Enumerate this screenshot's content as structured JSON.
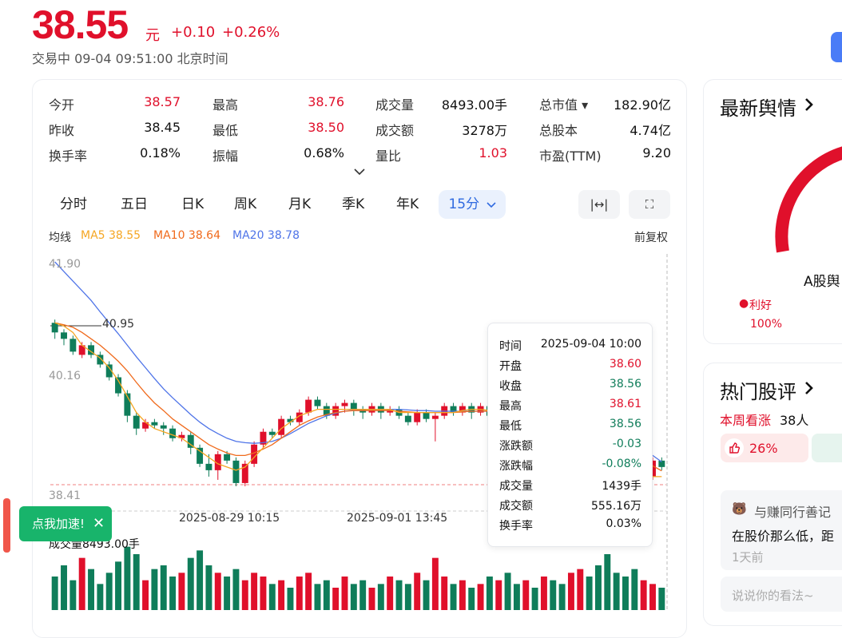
{
  "header": {
    "price": "38.55",
    "unit": "元",
    "change": "+0.10",
    "change_pct": "+0.26%",
    "status": "交易中  09-04 09:51:00  北京时间"
  },
  "quote": [
    {
      "label": "今开",
      "value": "38.57",
      "color": "red"
    },
    {
      "label": "最高",
      "value": "38.76",
      "color": "red"
    },
    {
      "label": "成交量",
      "value": "8493.00手",
      "color": "dark"
    },
    {
      "label": "总市值 ▾",
      "value": "182.90亿",
      "color": "dark"
    },
    {
      "label": "昨收",
      "value": "38.45",
      "color": "dark"
    },
    {
      "label": "最低",
      "value": "38.50",
      "color": "red"
    },
    {
      "label": "成交额",
      "value": "3278万",
      "color": "dark"
    },
    {
      "label": "总股本",
      "value": "4.74亿",
      "color": "dark"
    },
    {
      "label": "换手率",
      "value": "0.18%",
      "color": "dark"
    },
    {
      "label": "振幅",
      "value": "0.68%",
      "color": "dark"
    },
    {
      "label": "量比",
      "value": "1.03",
      "color": "red"
    },
    {
      "label": "市盈(TTM)",
      "value": "9.20",
      "color": "dark"
    }
  ],
  "tabs": [
    "分时",
    "五日",
    "日K",
    "周K",
    "月K",
    "季K",
    "年K",
    "15分"
  ],
  "tools": {
    "fit": "|↔|",
    "fullscreen": "⛶"
  },
  "ma": {
    "avg": "均线",
    "ma5": "MA5 38.55",
    "ma10": "MA10 38.64",
    "ma20": "MA20 38.78",
    "adjust": "前复权",
    "colors": {
      "ma5": "#f5a623",
      "ma10": "#f06a1c",
      "ma20": "#4f74e8"
    }
  },
  "chart_data": {
    "type": "candlestick",
    "y_ticks": [
      "41.90",
      "40.16",
      "38.41"
    ],
    "x_ticks": [
      "2025-08-29 10:15",
      "2025-09-01 13:45"
    ],
    "max_marker": "40.95",
    "volume_label": "成交量8493.00手",
    "candles": [
      [
        40.95,
        40.8,
        41.0,
        40.7
      ],
      [
        40.8,
        40.7,
        40.85,
        40.6
      ],
      [
        40.7,
        40.5,
        40.75,
        40.45
      ],
      [
        40.45,
        40.6,
        40.65,
        40.4
      ],
      [
        40.6,
        40.45,
        40.65,
        40.4
      ],
      [
        40.45,
        40.3,
        40.5,
        40.25
      ],
      [
        40.3,
        40.1,
        40.35,
        40.05
      ],
      [
        40.1,
        39.85,
        40.15,
        39.8
      ],
      [
        39.85,
        39.5,
        39.9,
        39.4
      ],
      [
        39.5,
        39.3,
        39.55,
        39.2
      ],
      [
        39.3,
        39.4,
        39.45,
        39.25
      ],
      [
        39.4,
        39.35,
        39.45,
        39.3
      ],
      [
        39.35,
        39.3,
        39.4,
        39.2
      ],
      [
        39.3,
        39.15,
        39.35,
        39.1
      ],
      [
        39.15,
        39.2,
        39.25,
        39.1
      ],
      [
        39.2,
        39.0,
        39.25,
        38.9
      ],
      [
        39.0,
        38.75,
        39.05,
        38.7
      ],
      [
        38.75,
        38.65,
        38.9,
        38.55
      ],
      [
        38.65,
        38.9,
        38.95,
        38.5
      ],
      [
        38.9,
        38.8,
        38.95,
        38.75
      ],
      [
        38.8,
        38.45,
        38.85,
        38.4
      ],
      [
        38.45,
        38.75,
        38.8,
        38.4
      ],
      [
        38.75,
        39.05,
        39.1,
        38.7
      ],
      [
        39.05,
        39.25,
        39.3,
        39.0
      ],
      [
        39.25,
        39.2,
        39.3,
        39.15
      ],
      [
        39.2,
        39.45,
        39.5,
        39.15
      ],
      [
        39.45,
        39.4,
        39.5,
        39.35
      ],
      [
        39.4,
        39.55,
        39.6,
        39.35
      ],
      [
        39.55,
        39.75,
        39.8,
        39.5
      ],
      [
        39.75,
        39.65,
        39.8,
        39.6
      ],
      [
        39.65,
        39.5,
        39.7,
        39.45
      ],
      [
        39.5,
        39.65,
        39.7,
        39.45
      ],
      [
        39.65,
        39.7,
        39.75,
        39.55
      ],
      [
        39.7,
        39.6,
        39.75,
        39.5
      ],
      [
        39.6,
        39.55,
        39.65,
        39.45
      ],
      [
        39.55,
        39.65,
        39.7,
        39.5
      ],
      [
        39.65,
        39.55,
        39.7,
        39.45
      ],
      [
        39.55,
        39.6,
        39.65,
        39.5
      ],
      [
        39.6,
        39.5,
        39.65,
        39.45
      ],
      [
        39.5,
        39.4,
        39.55,
        39.35
      ],
      [
        39.4,
        39.55,
        39.6,
        39.35
      ],
      [
        39.55,
        39.45,
        39.6,
        39.4
      ],
      [
        39.45,
        39.5,
        39.55,
        39.1
      ],
      [
        39.5,
        39.65,
        39.7,
        39.45
      ],
      [
        39.65,
        39.55,
        39.7,
        39.5
      ],
      [
        39.55,
        39.65,
        39.7,
        39.5
      ],
      [
        39.65,
        39.55,
        39.7,
        39.45
      ],
      [
        39.55,
        39.65,
        39.7,
        39.5
      ],
      [
        39.65,
        39.5,
        39.7,
        39.45
      ],
      [
        39.5,
        39.55,
        39.6,
        39.45
      ],
      [
        39.55,
        39.5,
        39.6,
        39.4
      ],
      [
        39.5,
        39.4,
        39.55,
        39.35
      ],
      [
        39.4,
        39.55,
        39.6,
        39.35
      ],
      [
        39.55,
        39.45,
        39.6,
        39.4
      ],
      [
        39.45,
        39.6,
        39.65,
        39.4
      ],
      [
        39.6,
        39.55,
        39.65,
        39.5
      ],
      [
        39.55,
        39.5,
        39.6,
        39.45
      ],
      [
        39.5,
        39.65,
        39.7,
        39.45
      ],
      [
        39.65,
        39.75,
        39.8,
        39.6
      ],
      [
        39.75,
        39.5,
        39.8,
        39.45
      ],
      [
        39.5,
        39.05,
        39.55,
        39.0
      ],
      [
        39.05,
        38.8,
        39.1,
        38.75
      ],
      [
        38.8,
        38.6,
        38.85,
        38.55
      ],
      [
        38.6,
        38.4,
        38.65,
        38.35
      ],
      [
        38.4,
        38.35,
        38.55,
        38.3
      ],
      [
        38.35,
        38.55,
        38.6,
        38.3
      ],
      [
        38.55,
        38.8,
        38.85,
        38.5
      ],
      [
        38.8,
        38.7,
        38.85,
        38.65
      ]
    ],
    "ma5": [
      40.95,
      40.9,
      40.8,
      40.6,
      40.5,
      40.4,
      40.25,
      40.05,
      39.8,
      39.55,
      39.4,
      39.3,
      39.25,
      39.2,
      39.15,
      39.05,
      38.95,
      38.85,
      38.75,
      38.7,
      38.65,
      38.7,
      38.85,
      39.0,
      39.15,
      39.3,
      39.4,
      39.5,
      39.55,
      39.6,
      39.6,
      39.6,
      39.6,
      39.6,
      39.6,
      39.6,
      39.6,
      39.6,
      39.55,
      39.55,
      39.55,
      39.55,
      39.55,
      39.55,
      39.55,
      39.58,
      39.6,
      39.6,
      39.58,
      39.55,
      39.52,
      39.5,
      39.48,
      39.48,
      39.5,
      39.52,
      39.55,
      39.58,
      39.62,
      39.6,
      39.45,
      39.2,
      38.95,
      38.75,
      38.6,
      38.55,
      38.55,
      38.55
    ],
    "ma10": [
      40.95,
      40.92,
      40.88,
      40.8,
      40.7,
      40.6,
      40.48,
      40.35,
      40.2,
      40.02,
      39.85,
      39.7,
      39.58,
      39.45,
      39.35,
      39.25,
      39.15,
      39.05,
      38.98,
      38.92,
      38.88,
      38.88,
      38.92,
      38.98,
      39.05,
      39.15,
      39.25,
      39.35,
      39.42,
      39.48,
      39.52,
      39.55,
      39.57,
      39.58,
      39.58,
      39.58,
      39.58,
      39.58,
      39.57,
      39.56,
      39.55,
      39.55,
      39.55,
      39.55,
      39.55,
      39.56,
      39.57,
      39.57,
      39.57,
      39.56,
      39.55,
      39.54,
      39.53,
      39.52,
      39.52,
      39.53,
      39.54,
      39.56,
      39.58,
      39.58,
      39.52,
      39.4,
      39.25,
      39.1,
      38.95,
      38.82,
      38.72,
      38.64
    ],
    "ma20": [
      41.9,
      41.75,
      41.6,
      41.45,
      41.3,
      41.12,
      40.95,
      40.78,
      40.6,
      40.42,
      40.25,
      40.08,
      39.92,
      39.78,
      39.65,
      39.52,
      39.4,
      39.3,
      39.22,
      39.15,
      39.1,
      39.08,
      39.07,
      39.08,
      39.1,
      39.15,
      39.22,
      39.3,
      39.38,
      39.44,
      39.5,
      39.54,
      39.57,
      39.59,
      39.6,
      39.6,
      39.6,
      39.6,
      39.6,
      39.59,
      39.58,
      39.58,
      39.57,
      39.57,
      39.57,
      39.57,
      39.57,
      39.57,
      39.57,
      39.57,
      39.57,
      39.57,
      39.56,
      39.56,
      39.55,
      39.55,
      39.55,
      39.55,
      39.55,
      39.55,
      39.52,
      39.45,
      39.35,
      39.22,
      39.1,
      38.98,
      38.88,
      38.78
    ],
    "volume": [
      45,
      60,
      40,
      70,
      55,
      35,
      50,
      65,
      85,
      75,
      40,
      55,
      60,
      45,
      50,
      70,
      80,
      60,
      50,
      45,
      55,
      40,
      50,
      45,
      35,
      40,
      30,
      45,
      50,
      35,
      40,
      30,
      45,
      35,
      40,
      30,
      35,
      45,
      40,
      35,
      50,
      40,
      70,
      45,
      35,
      40,
      30,
      35,
      45,
      40,
      50,
      35,
      40,
      30,
      45,
      40,
      35,
      50,
      55,
      45,
      60,
      75,
      50,
      45,
      55,
      40,
      35,
      30
    ]
  },
  "tooltip": [
    {
      "k": "时间",
      "v": "2025-09-04 10:00",
      "color": "dark"
    },
    {
      "k": "开盘",
      "v": "38.60",
      "color": "red"
    },
    {
      "k": "收盘",
      "v": "38.56",
      "color": "green"
    },
    {
      "k": "最高",
      "v": "38.61",
      "color": "red"
    },
    {
      "k": "最低",
      "v": "38.56",
      "color": "green"
    },
    {
      "k": "涨跌额",
      "v": "-0.03",
      "color": "green"
    },
    {
      "k": "涨跌幅",
      "v": "-0.08%",
      "color": "green"
    },
    {
      "k": "成交量",
      "v": "1439手",
      "color": "dark"
    },
    {
      "k": "成交额",
      "v": "555.16万",
      "color": "dark"
    },
    {
      "k": "换手率",
      "v": "0.03%",
      "color": "dark"
    }
  ],
  "float": {
    "speed": "点我加速!",
    "close": "✕"
  },
  "right": {
    "sentiment_title": "最新舆情",
    "sentiment_label": "A股舆",
    "good_label": "利好",
    "good_value": "100%",
    "hot_title": "热门股评",
    "weekly_label": "本周看涨",
    "weekly_count": "38人",
    "bull_pct": "26%",
    "comment_user": "与赚同行善记",
    "comment_text": "在股价那么低，距",
    "comment_time": "1天前",
    "say_placeholder": "说说你的看法~"
  }
}
